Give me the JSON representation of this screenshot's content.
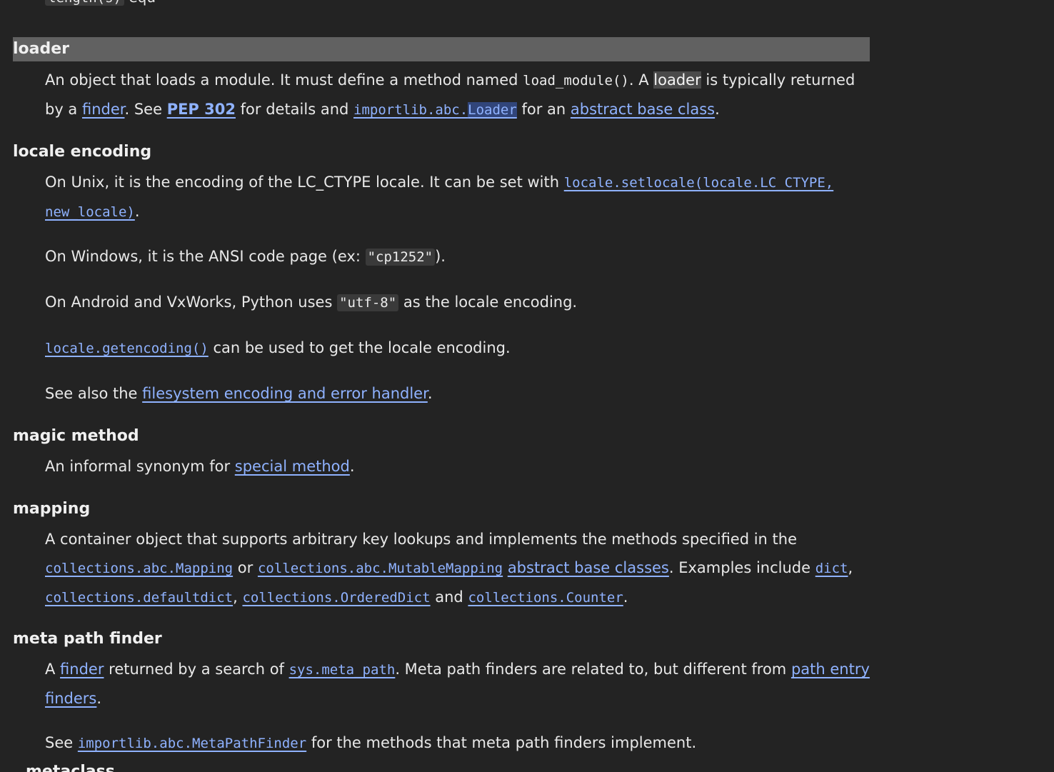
{
  "top_partial": {
    "code": "length(s)",
    "text": "equ"
  },
  "entries": {
    "loader": {
      "term": "loader",
      "p1": {
        "t1": "An object that loads a module. It must define a method named ",
        "code1": "load_module()",
        "t2": ". A ",
        "hit": "loader",
        "t3": " is typically returned by a ",
        "link_finder": "finder",
        "t4": ". See ",
        "link_pep": "PEP 302",
        "t5": " for details and ",
        "link_abc_prefix": "importlib.abc.",
        "link_abc_sel": "Loader",
        "t6": " for an ",
        "link_abc_class": "abstract base class",
        "t7": "."
      }
    },
    "locale_encoding": {
      "term": "locale encoding",
      "p1": {
        "t1": "On Unix, it is the encoding of the LC_CTYPE locale. It can be set with ",
        "link_setlocale": "locale.setlocale(locale.LC_CTYPE, new_locale)",
        "t2": "."
      },
      "p2": {
        "t1": "On Windows, it is the ANSI code page (ex: ",
        "code": "\"cp1252\"",
        "t2": ")."
      },
      "p3": {
        "t1": "On Android and VxWorks, Python uses ",
        "code": "\"utf-8\"",
        "t2": " as the locale encoding."
      },
      "p4": {
        "link_getencoding": "locale.getencoding()",
        "t1": " can be used to get the locale encoding."
      },
      "p5": {
        "t1": "See also the ",
        "link_fs": "filesystem encoding and error handler",
        "t2": "."
      }
    },
    "magic_method": {
      "term": "magic method",
      "p1": {
        "t1": "An informal synonym for ",
        "link_special": "special method",
        "t2": "."
      }
    },
    "mapping": {
      "term": "mapping",
      "p1": {
        "t1": "A container object that supports arbitrary key lookups and implements the methods specified in the ",
        "link_mapping": "collections.abc.Mapping",
        "t2": " or ",
        "link_mutable": "collections.abc.MutableMapping",
        "t3": " ",
        "link_abcs": "abstract base classes",
        "t4": ". Examples include ",
        "link_dict": "dict",
        "t5": ", ",
        "link_defaultdict": "collections.defaultdict",
        "t6": ", ",
        "link_ordereddict": "collections.OrderedDict",
        "t7": " and ",
        "link_counter": "collections.Counter",
        "t8": "."
      }
    },
    "meta_path_finder": {
      "term": "meta path finder",
      "p1": {
        "t1": "A ",
        "link_finder": "finder",
        "t2": " returned by a search of ",
        "link_sys": "sys.meta_path",
        "t3": ". Meta path finders are related to, but different from ",
        "link_pef": "path entry finders",
        "t4": "."
      },
      "p2": {
        "t1": "See ",
        "link_mpf": "importlib.abc.MetaPathFinder",
        "t2": " for the methods that meta path finders implement."
      }
    }
  },
  "bottom_partial": "metaclass"
}
